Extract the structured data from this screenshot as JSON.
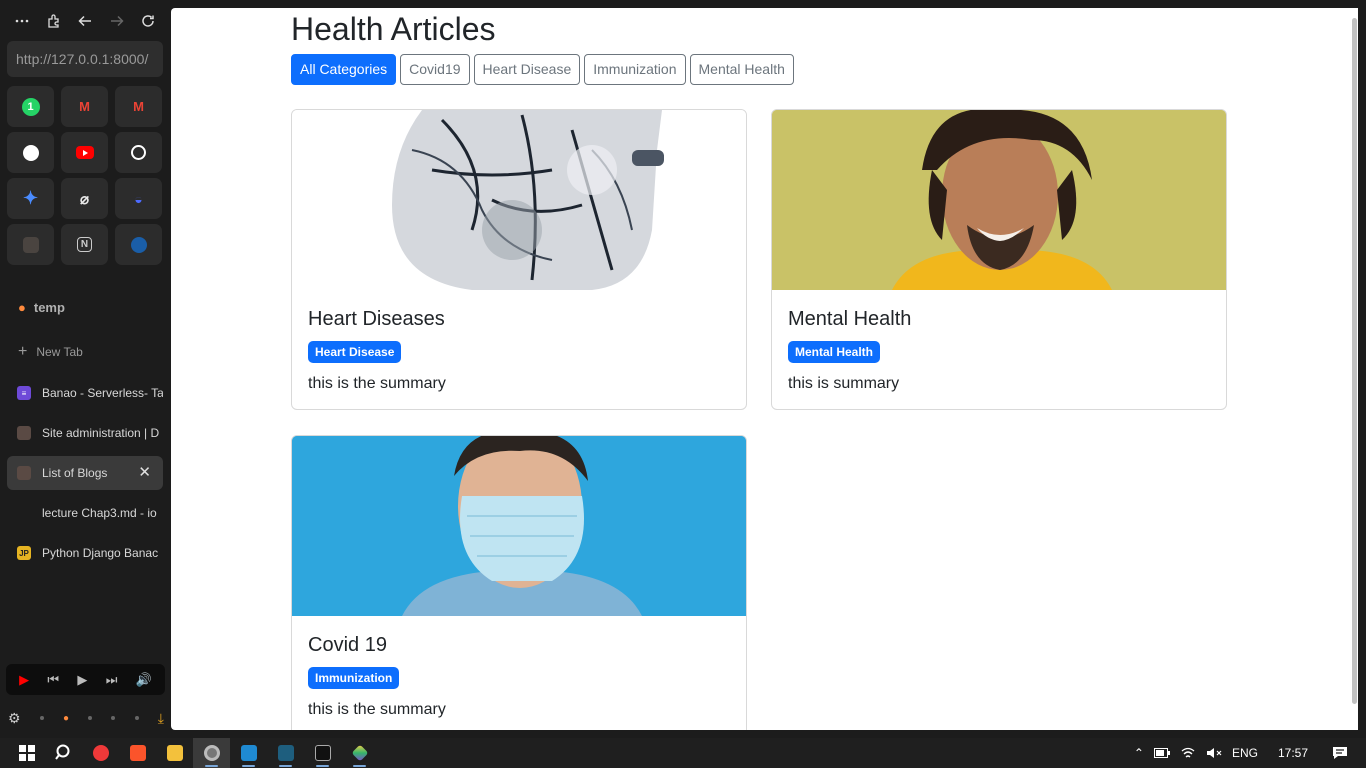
{
  "browser": {
    "url": "http://127.0.0.1:8000/",
    "folder_label": "temp",
    "new_tab_label": "New Tab",
    "tabs": [
      {
        "title": "Banao - Serverless- Ta",
        "favicon_color": "#6e4ad8"
      },
      {
        "title": "Site administration | D",
        "favicon_color": "#5a4a44"
      },
      {
        "title": "List of Blogs",
        "favicon_color": "#5a4a44",
        "active": true
      },
      {
        "title": "lecture Chap3.md - io",
        "favicon_color": "#1c1c1c"
      },
      {
        "title": "Python Django Banac",
        "favicon_color": "#e6b422",
        "favicon_text": "JP"
      }
    ],
    "pinned": [
      {
        "icon": "whatsapp-icon",
        "color": "#25d366",
        "text": "1"
      },
      {
        "icon": "gmail-icon",
        "color": "#ea4335",
        "text": "M"
      },
      {
        "icon": "gmail-icon",
        "color": "#ea4335",
        "text": "M"
      },
      {
        "icon": "github-icon",
        "color": "#ffffff",
        "text": ""
      },
      {
        "icon": "youtube-icon",
        "color": "#ff0000",
        "text": ""
      },
      {
        "icon": "chatgpt-icon",
        "color": "#ffffff",
        "text": ""
      },
      {
        "icon": "gemini-icon",
        "color": "#4a8cff",
        "text": ""
      },
      {
        "icon": "perplexity-icon",
        "color": "#e8e8e8",
        "text": ""
      },
      {
        "icon": "deepseek-icon",
        "color": "#4d6bfe",
        "text": ""
      },
      {
        "icon": "app-icon",
        "color": "#4a4440",
        "text": ""
      },
      {
        "icon": "notion-icon",
        "color": "#e8e8e8",
        "text": "N"
      },
      {
        "icon": "browser-icon",
        "color": "#2a7bd4",
        "text": ""
      }
    ]
  },
  "page": {
    "title": "Health Articles",
    "filters": [
      {
        "label": "All Categories",
        "active": true
      },
      {
        "label": "Covid19",
        "active": false
      },
      {
        "label": "Heart Disease",
        "active": false
      },
      {
        "label": "Immunization",
        "active": false
      },
      {
        "label": "Mental Health",
        "active": false
      }
    ],
    "articles": [
      {
        "title": "Heart Diseases",
        "category": "Heart Disease",
        "summary": "this is the summary",
        "image": "heart-illustration"
      },
      {
        "title": "Mental Health",
        "category": "Mental Health",
        "summary": "this is summary",
        "image": "smiling-man-photo"
      },
      {
        "title": "Covid 19",
        "category": "Immunization",
        "summary": "this is the summary",
        "image": "masked-man-photo"
      }
    ]
  },
  "taskbar": {
    "language": "ENG",
    "time": "17:57"
  },
  "colors": {
    "primary": "#0d6efd",
    "outline": "#6c757d",
    "sidebar_bg": "#1c1c1c"
  }
}
